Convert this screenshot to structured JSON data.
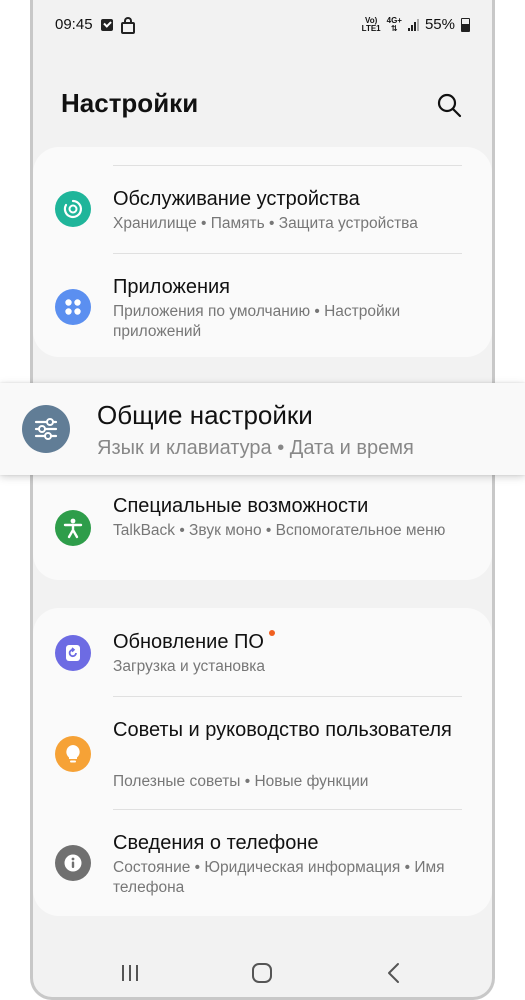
{
  "status_bar": {
    "time": "09:45",
    "lte_top": "Vo)",
    "lte_bottom": "LTE1",
    "net_top": "4G+",
    "battery": "55%"
  },
  "header": {
    "title": "Настройки"
  },
  "items": [
    {
      "title": "Обслуживание устройства",
      "subtitle": "Хранилище  •  Память  •  Защита устройства",
      "icon": "device-care-icon",
      "color": "#1fb59a"
    },
    {
      "title": "Приложения",
      "subtitle": "Приложения по умолчанию  •  Настройки приложений",
      "icon": "apps-icon",
      "color": "#5b8ff0"
    },
    {
      "title": "Общие настройки",
      "subtitle": "Язык и клавиатура  •  Дата и время",
      "icon": "sliders-icon",
      "color": "#617d96"
    },
    {
      "title": "Специальные возможности",
      "subtitle": "TalkBack  •  Звук моно  •  Вспомогательное меню",
      "icon": "accessibility-icon",
      "color": "#2e9d4a"
    },
    {
      "title": "Обновление ПО",
      "subtitle": "Загрузка и установка",
      "icon": "software-update-icon",
      "color": "#6d6be3",
      "badge_color": "#f06020"
    },
    {
      "title": "Советы и руководство пользователя",
      "subtitle": "Полезные советы  •  Новые функции",
      "icon": "lightbulb-icon",
      "color": "#f6a236"
    },
    {
      "title": "Сведения о телефоне",
      "subtitle": "Состояние  •  Юридическая информация  •  Имя телефона",
      "icon": "info-icon",
      "color": "#707070"
    }
  ]
}
